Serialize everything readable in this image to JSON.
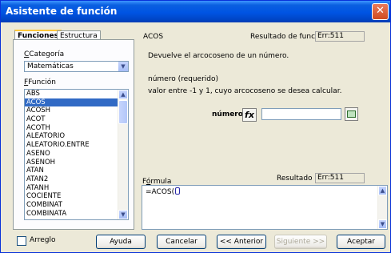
{
  "window": {
    "title": "Asistente de función",
    "close_label": "✕"
  },
  "tabs": [
    {
      "label": "Funciones"
    },
    {
      "label": "Estructura"
    }
  ],
  "category": {
    "label": "Categoría",
    "value": "Matemáticas"
  },
  "function_list": {
    "label": "Función",
    "items": [
      "ABS",
      "ACOS",
      "ACOSH",
      "ACOT",
      "ACOTH",
      "ALEATORIO",
      "ALEATORIO.ENTRE",
      "ASENO",
      "ASENOH",
      "ATAN",
      "ATAN2",
      "ATANH",
      "COCIENTE",
      "COMBINAT",
      "COMBINATA"
    ],
    "selected": "ACOS"
  },
  "details": {
    "function_name": "ACOS",
    "result_label": "Resultado de función",
    "result_value": "Err:511",
    "description": "Devuelve el arcocoseno de un número.",
    "param_heading": "número (requerido)",
    "param_description": "valor entre -1 y 1, cuyo arcocoseno se desea calcular.",
    "param_label": "número",
    "fx_label": "fx",
    "param_value": ""
  },
  "formula": {
    "label": "Fórmula",
    "result_label": "Resultado",
    "result_value": "Err:511",
    "text": "=ACOS("
  },
  "footer": {
    "array_label": "Arreglo",
    "help": "Ayuda",
    "cancel": "Cancelar",
    "back": "<< Anterior",
    "next": "Siguiente >>",
    "accept": "Aceptar"
  },
  "colors": {
    "title_bar": "#0054e3",
    "selection": "#316ac5",
    "dialog_bg": "#ece9d8"
  }
}
